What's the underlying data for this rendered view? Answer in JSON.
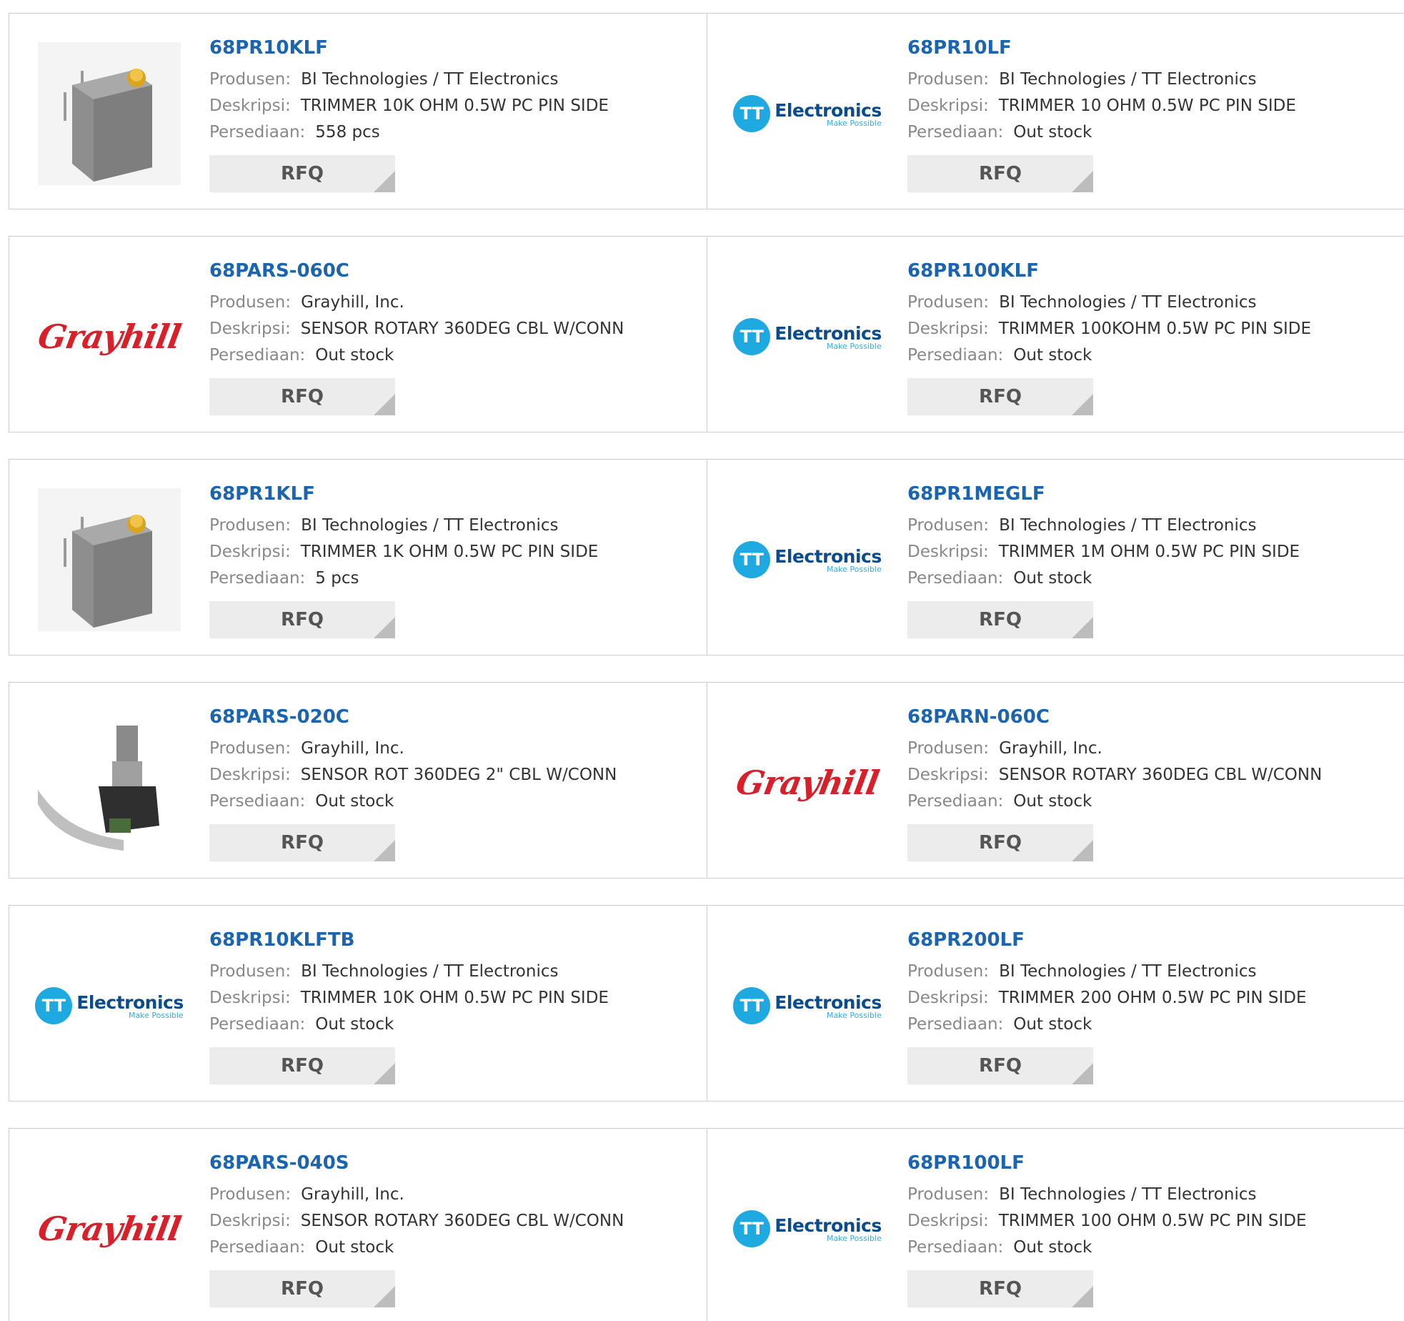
{
  "labels": {
    "producer": "Produsen:",
    "description": "Deskripsi:",
    "stock": "Persediaan:",
    "rfq": "RFQ"
  },
  "brand_logos": {
    "tt": {
      "mark": "TT",
      "word": "Electronics",
      "tagline": "Make Possible",
      "color": "#1fa9e1"
    },
    "grayhill": {
      "word": "Grayhill",
      "color": "#d8202a"
    }
  },
  "products": [
    {
      "part": "68PR10KLF",
      "producer": "BI Technologies / TT Electronics",
      "description": "TRIMMER 10K OHM 0.5W PC PIN SIDE",
      "stock": "558 pcs",
      "image": "trimmer-photo"
    },
    {
      "part": "68PR10LF",
      "producer": "BI Technologies / TT Electronics",
      "description": "TRIMMER 10 OHM 0.5W PC PIN SIDE",
      "stock": "Out stock",
      "image": "tt-logo"
    },
    {
      "part": "68PARS-060C",
      "producer": "Grayhill, Inc.",
      "description": "SENSOR ROTARY 360DEG CBL W/CONN",
      "stock": "Out stock",
      "image": "grayhill-logo"
    },
    {
      "part": "68PR100KLF",
      "producer": "BI Technologies / TT Electronics",
      "description": "TRIMMER 100KOHM 0.5W PC PIN SIDE",
      "stock": "Out stock",
      "image": "tt-logo"
    },
    {
      "part": "68PR1KLF",
      "producer": "BI Technologies / TT Electronics",
      "description": "TRIMMER 1K OHM 0.5W PC PIN SIDE",
      "stock": "5 pcs",
      "image": "trimmer-photo"
    },
    {
      "part": "68PR1MEGLF",
      "producer": "BI Technologies / TT Electronics",
      "description": "TRIMMER 1M OHM 0.5W PC PIN SIDE",
      "stock": "Out stock",
      "image": "tt-logo"
    },
    {
      "part": "68PARS-020C",
      "producer": "Grayhill, Inc.",
      "description": "SENSOR ROT 360DEG 2\" CBL W/CONN",
      "stock": "Out stock",
      "image": "encoder-photo"
    },
    {
      "part": "68PARN-060C",
      "producer": "Grayhill, Inc.",
      "description": "SENSOR ROTARY 360DEG CBL W/CONN",
      "stock": "Out stock",
      "image": "grayhill-logo"
    },
    {
      "part": "68PR10KLFTB",
      "producer": "BI Technologies / TT Electronics",
      "description": "TRIMMER 10K OHM 0.5W PC PIN SIDE",
      "stock": "Out stock",
      "image": "tt-logo"
    },
    {
      "part": "68PR200LF",
      "producer": "BI Technologies / TT Electronics",
      "description": "TRIMMER 200 OHM 0.5W PC PIN SIDE",
      "stock": "Out stock",
      "image": "tt-logo"
    },
    {
      "part": "68PARS-040S",
      "producer": "Grayhill, Inc.",
      "description": "SENSOR ROTARY 360DEG CBL W/CONN",
      "stock": "Out stock",
      "image": "grayhill-logo"
    },
    {
      "part": "68PR100LF",
      "producer": "BI Technologies / TT Electronics",
      "description": "TRIMMER 100 OHM 0.5W PC PIN SIDE",
      "stock": "Out stock",
      "image": "tt-logo"
    }
  ]
}
